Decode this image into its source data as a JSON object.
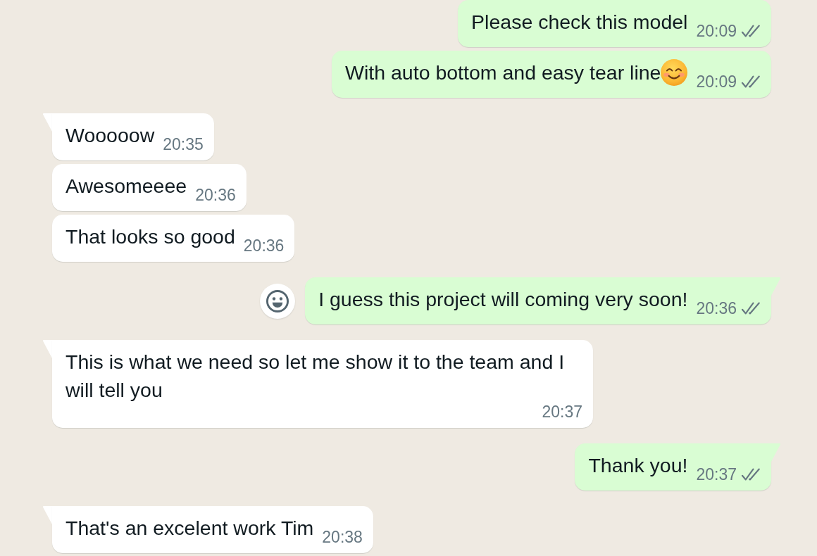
{
  "messages": [
    {
      "kind": "outgoing",
      "text": "Please check this model",
      "trailing_emoji": false,
      "time": "20:09",
      "read": false,
      "tail": false,
      "hovered": false
    },
    {
      "kind": "outgoing",
      "text": "With auto bottom and easy tear line",
      "trailing_emoji": true,
      "time": "20:09",
      "read": false,
      "tail": false,
      "hovered": false
    },
    {
      "kind": "incoming",
      "text": "Wooooow",
      "trailing_emoji": false,
      "time": "20:35",
      "tail": true,
      "hovered": false
    },
    {
      "kind": "incoming",
      "text": "Awesomeeee",
      "trailing_emoji": false,
      "time": "20:36",
      "tail": false,
      "hovered": false
    },
    {
      "kind": "incoming",
      "text": "That looks so good",
      "trailing_emoji": false,
      "time": "20:36",
      "tail": false,
      "hovered": false
    },
    {
      "kind": "outgoing",
      "text": "I guess this project will coming very soon!",
      "trailing_emoji": false,
      "time": "20:36",
      "read": false,
      "tail": true,
      "hovered": true
    },
    {
      "kind": "incoming",
      "text": "This is what we need so let me show it to the team and I will tell you",
      "trailing_emoji": false,
      "time": "20:37",
      "tail": true,
      "hovered": false
    },
    {
      "kind": "outgoing",
      "text": "Thank you!",
      "trailing_emoji": false,
      "time": "20:37",
      "read": false,
      "tail": true,
      "hovered": false
    },
    {
      "kind": "incoming",
      "text": "That's an excelent work Tim",
      "trailing_emoji": false,
      "time": "20:38",
      "tail": true,
      "hovered": false
    }
  ]
}
